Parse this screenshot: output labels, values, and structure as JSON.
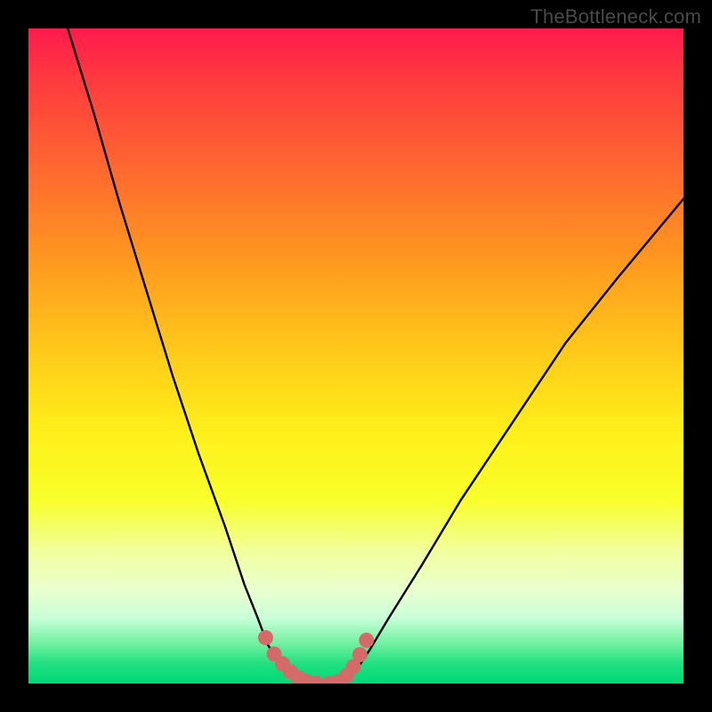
{
  "watermark": "TheBottleneck.com",
  "colors": {
    "background": "#000000",
    "gradient_top": "#ff1a4d",
    "gradient_mid": "#fff01a",
    "gradient_bottom": "#00d878",
    "curve": "#000000",
    "marker": "#d46a6a"
  },
  "chart_data": {
    "type": "line",
    "title": "",
    "xlabel": "",
    "ylabel": "",
    "xlim": [
      0,
      100
    ],
    "ylim": [
      0,
      100
    ],
    "series": [
      {
        "name": "left-branch",
        "x": [
          6,
          10,
          14,
          18,
          22,
          26,
          30,
          33,
          35,
          36.5,
          38,
          39,
          40,
          41,
          42
        ],
        "y": [
          100,
          87,
          73,
          60,
          47,
          35,
          24,
          15,
          10,
          6,
          3.5,
          2,
          1,
          0.5,
          0
        ]
      },
      {
        "name": "flat-bottom",
        "x": [
          42,
          44,
          46,
          48
        ],
        "y": [
          0,
          0,
          0,
          0
        ]
      },
      {
        "name": "right-branch",
        "x": [
          48,
          49,
          50,
          52,
          55,
          60,
          66,
          74,
          82,
          90,
          100
        ],
        "y": [
          0,
          1,
          2,
          5,
          10,
          18,
          28,
          40,
          52,
          62,
          74
        ]
      }
    ],
    "markers": {
      "name": "highlight-dots",
      "x": [
        36.2,
        37.5,
        38.8,
        40.0,
        41.2,
        42.5,
        44.0,
        46.0,
        47.5,
        48.6,
        49.6,
        50.6,
        51.6
      ],
      "y": [
        7.0,
        4.5,
        3.0,
        1.8,
        0.9,
        0.3,
        0.0,
        0.0,
        0.3,
        1.2,
        2.6,
        4.4,
        6.6
      ]
    }
  }
}
